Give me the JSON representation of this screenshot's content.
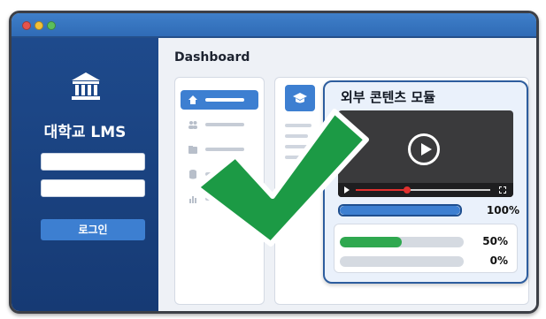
{
  "sidebar": {
    "title": "대학교 LMS",
    "login_label": "로그인",
    "logo_icon": "university-building-icon"
  },
  "main": {
    "title": "Dashboard",
    "nav_icons": [
      "home-icon",
      "users-icon",
      "folder-icon",
      "database-icon",
      "chart-icon"
    ],
    "active_nav_index": 0
  },
  "module": {
    "title": "외부 콘텐츠 모듈",
    "video_progress": 0.38,
    "progress_bars": [
      {
        "label": "100%",
        "value": 1.0,
        "color": "#3d7fd1"
      },
      {
        "label": "50%",
        "value": 0.5,
        "color": "#2fa84f"
      },
      {
        "label": "0%",
        "value": 0.0,
        "color": "#2fa84f"
      }
    ]
  },
  "colors": {
    "accent": "#3d7fd1",
    "sidebar": "#1e4a8c",
    "check": "#1c9a45"
  },
  "overlay_icon": "checkmark-icon"
}
